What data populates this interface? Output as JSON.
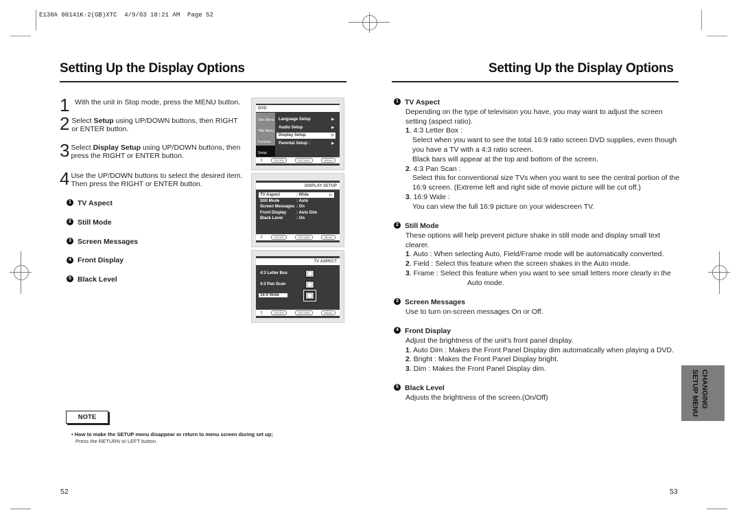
{
  "print_header": "E138A 00141K-2(GB)XTC  4/9/03 10:21 AM  Page 52",
  "left_page": {
    "title": "Setting Up the Display Options",
    "steps": [
      {
        "num": "1",
        "text_parts": [
          {
            "t": "With the unit in Stop mode, press the MENU button.",
            "b": false
          }
        ]
      },
      {
        "num": "2",
        "text_parts": [
          {
            "t": "Select ",
            "b": false
          },
          {
            "t": "Setup",
            "b": true
          },
          {
            "t": " using UP/DOWN buttons, then RIGHT or ENTER button.",
            "b": false
          }
        ]
      },
      {
        "num": "3",
        "text_parts": [
          {
            "t": "Select ",
            "b": false
          },
          {
            "t": "Display Setup",
            "b": true
          },
          {
            "t": " using UP/DOWN buttons, then press the RIGHT or ENTER button.",
            "b": false
          }
        ]
      },
      {
        "num": "4",
        "text_parts": [
          {
            "t": "Use the UP/DOWN buttons to select the desired item. Then press the RIGHT or ENTER button.",
            "b": false
          }
        ]
      }
    ],
    "items": [
      {
        "marker": "1",
        "label": "TV Aspect"
      },
      {
        "marker": "2",
        "label": "Still Mode"
      },
      {
        "marker": "3",
        "label": "Screen Messages"
      },
      {
        "marker": "4",
        "label": "Front Display"
      },
      {
        "marker": "5",
        "label": "Black Level"
      }
    ],
    "screen1": {
      "header": "DVD",
      "tabs": [
        "Disc Menu",
        "Title Menu",
        "Function",
        "Setup"
      ],
      "menu": [
        {
          "label": "Language Setup",
          "arrow": "▶"
        },
        {
          "label": "Audio Setup",
          "arrow": "▶"
        },
        {
          "label": "Display Setup",
          "arrow": "▷",
          "selected": true
        },
        {
          "label": "Parental Setup :",
          "arrow": "▶"
        }
      ],
      "buttons": [
        "ENTER",
        "RETURN",
        "MENU"
      ]
    },
    "screen2": {
      "header": "DISPLAY SETUP",
      "rows": [
        {
          "label": "TV Aspect",
          "value": ": Wide",
          "selected": true
        },
        {
          "label": "Still Mode",
          "value": ": Auto"
        },
        {
          "label": "Screen Messages",
          "value": ": On"
        },
        {
          "label": "Front Display",
          "value": ": Auto Dim"
        },
        {
          "label": "Black Level",
          "value": ": On"
        }
      ],
      "buttons": [
        "ENTER",
        "RETURN",
        "MENU"
      ]
    },
    "screen3": {
      "header": "TV ASPECT",
      "options": [
        {
          "label": "4:3 Letter Box"
        },
        {
          "label": "4:3 Pan Scan"
        },
        {
          "label": "16:9 Wide",
          "selected": true
        }
      ],
      "buttons": [
        "ENTER",
        "RETURN",
        "MENU"
      ]
    },
    "note": {
      "label": "NOTE",
      "bold_line": "• How to make the SETUP menu disappear or return to menu screen during set up;",
      "line2": "Press the RETURN or LEFT button."
    },
    "page_number": "52"
  },
  "right_page": {
    "title": "Setting Up the Display Options",
    "sections": [
      {
        "marker": "1",
        "heading": "TV Aspect",
        "lines": [
          {
            "t": "Depending on the type of television you have, you may want to adjust the screen",
            "indent": 0
          },
          {
            "t": "setting (aspect ratio).",
            "indent": 0
          },
          {
            "n": "1",
            "t": ". 4:3 Letter Box :",
            "indent": 0
          },
          {
            "t": "Select when you want to see the total 16:9 ratio screen DVD supplies, even though",
            "indent": 1
          },
          {
            "t": "you have a TV with a 4:3 ratio screen.",
            "indent": 1
          },
          {
            "t": "Black bars will appear at the top and bottom of the screen.",
            "indent": 1
          },
          {
            "n": "2",
            "t": ". 4:3 Pan Scan :",
            "indent": 0
          },
          {
            "t": "Select this for conventional size TVs when you want to see the central portion of the",
            "indent": 1
          },
          {
            "t": "16:9 screen. (Extreme left and right side of movie picture will be cut off.)",
            "indent": 1
          },
          {
            "n": "3",
            "t": ". 16:9 Wide :",
            "indent": 0
          },
          {
            "t": "You can view the full 16:9 picture on your widescreen TV.",
            "indent": 1
          }
        ]
      },
      {
        "marker": "2",
        "heading": "Still Mode",
        "lines": [
          {
            "t": "These options will help prevent picture shake in still mode and display small text",
            "indent": 0
          },
          {
            "t": "clearer.",
            "indent": 0
          },
          {
            "n": "1",
            "t": ". Auto : When selecting Auto, Field/Frame mode will be automatically converted.",
            "indent": 0
          },
          {
            "n": "2",
            "t": ". Field : Select this feature when the screen shakes in the Auto mode.",
            "indent": 0
          },
          {
            "n": "3",
            "t": ". Frame : Select this feature when you want to see small letters more clearly in the",
            "indent": 0
          },
          {
            "t": "Auto mode.",
            "indent": 2
          }
        ]
      },
      {
        "marker": "3",
        "heading": "Screen Messages",
        "lines": [
          {
            "t": "Use to turn on-screen messages On or Off.",
            "indent": 0
          }
        ]
      },
      {
        "marker": "4",
        "heading": "Front Display",
        "lines": [
          {
            "t": "Adjust the brightness of the unit's front panel display.",
            "indent": 0
          },
          {
            "n": "1",
            "t": ". Auto Dim : Makes the Front Panel Display dim automatically when playing a DVD.",
            "indent": 0
          },
          {
            "n": "2",
            "t": ". Bright : Makes the Front Panel Display bright.",
            "indent": 0
          },
          {
            "n": "3",
            "t": ". Dim : Makes the Front Panel Display dim.",
            "indent": 0
          }
        ]
      },
      {
        "marker": "5",
        "heading": "Black Level",
        "lines": [
          {
            "t": "Adjusts the brightness of the screen.(On/Off)",
            "indent": 0
          }
        ]
      }
    ],
    "side_tab": {
      "line1": "CHANGING",
      "line2": "SETUP MENU"
    },
    "page_number": "53"
  }
}
